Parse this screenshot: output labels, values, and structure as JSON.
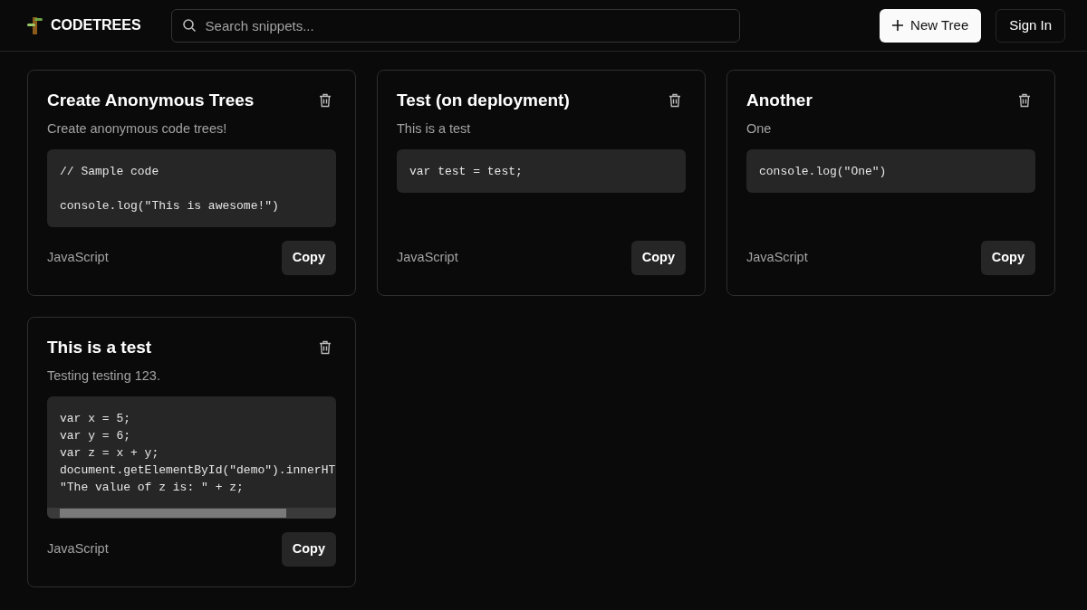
{
  "brand": "CODETREES",
  "search": {
    "placeholder": "Search snippets..."
  },
  "actions": [
    {
      "label": "New Tree",
      "kind": "primary"
    },
    {
      "label": "Sign In",
      "kind": "outline"
    }
  ],
  "snippets": [
    {
      "title": "Create Anonymous Trees",
      "description": "Create anonymous code trees!",
      "code": [
        {
          "text": "// Sample code",
          "gap_after": true
        },
        {
          "text": "console.log(\"This is awesome!\")",
          "gap_after": false
        }
      ],
      "scrollable": false,
      "language": "JavaScript",
      "copy": "Copy"
    },
    {
      "title": "Test (on deployment)",
      "description": "This is a test",
      "code": [
        {
          "text": "var test = test;",
          "gap_after": false
        }
      ],
      "scrollable": false,
      "language": "JavaScript",
      "copy": "Copy"
    },
    {
      "title": "Another",
      "description": "One",
      "code": [
        {
          "text": "console.log(\"One\")",
          "gap_after": false
        }
      ],
      "scrollable": false,
      "language": "JavaScript",
      "copy": "Copy"
    },
    {
      "title": "This is a test",
      "description": "Testing testing 123.",
      "code": [
        {
          "text": "var x = 5;",
          "gap_after": false
        },
        {
          "text": "var y = 6;",
          "gap_after": false
        },
        {
          "text": "var z = x + y;",
          "gap_after": false
        },
        {
          "text": "document.getElementById(\"demo\").innerHT",
          "gap_after": false
        },
        {
          "text": "\"The value of z is: \" + z;",
          "gap_after": false
        }
      ],
      "scrollable": true,
      "language": "JavaScript",
      "copy": "Copy"
    }
  ]
}
